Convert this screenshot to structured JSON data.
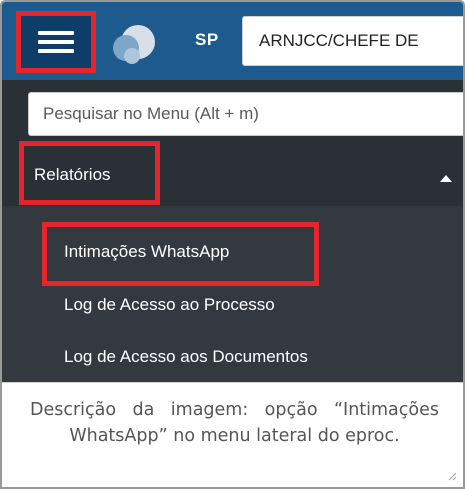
{
  "header": {
    "menu_icon": "hamburger-menu-icon",
    "logo_icon": "eproc-logo-icon",
    "state": "SP",
    "unit_selector_value": "ARNJCC/CHEFE DE"
  },
  "sidebar": {
    "search_placeholder": "Pesquisar no Menu (Alt + m)",
    "section": {
      "label": "Relatórios",
      "caret_icon": "caret-up-icon",
      "items": [
        {
          "label": "Intimações WhatsApp"
        },
        {
          "label": "Log de Acesso ao Processo"
        },
        {
          "label": "Log de Acesso aos Documentos"
        }
      ]
    }
  },
  "caption": {
    "text": "Descrição da imagem: opção “Intimações WhatsApp” no menu lateral do eproc."
  },
  "colors": {
    "header_bg": "#1d5a8e",
    "sidebar_bg": "#2b3036",
    "submenu_bg": "#343940",
    "highlight": "#e3262e"
  }
}
